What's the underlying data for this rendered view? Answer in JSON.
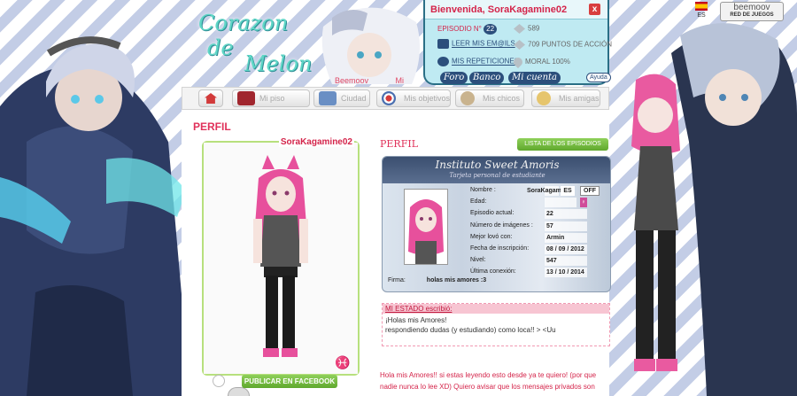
{
  "header": {
    "logo_line1": "Corazon",
    "logo_line2": "de",
    "logo_line3": "Melon",
    "by_text": "Beemoov",
    "by_suffix": "Mi"
  },
  "panel": {
    "welcome": "Bienvenida, SoraKagamine02",
    "close": "x",
    "episode_label": "EPISODIO N°",
    "episode_number": "22",
    "read_emails": "LEER MIS EM@ILS",
    "repetitions": "MIS REPETICIONES",
    "stat_coins": "589",
    "stat_action": "709 PUNTOS DE ACCIÓN",
    "stat_moral": "MORAL 100%",
    "buttons": [
      "Foro",
      "Banco",
      "Mi cuenta"
    ],
    "help": "Ayuda"
  },
  "lang": "ES",
  "beemoov": {
    "title": "beemoov",
    "sub": "RED DE JUEGOS"
  },
  "nav": {
    "tabs": [
      "Mi piso",
      "Ciudad",
      "Mis objetivos",
      "Mis chicos",
      "Mis amigas"
    ]
  },
  "profile": {
    "page_title": "PERFIL",
    "username": "SoraKagamine02",
    "facebook_button": "PUBLICAR EN FACEBOOK",
    "perfil_subtitle": "PERFIL",
    "episodes_button": "LISTA DE LOS EPISODIOS",
    "zodiac": "♓"
  },
  "idcard": {
    "title": "Instituto Sweet Amoris",
    "subtitle": "Tarjeta personal de estudiante",
    "rows": [
      {
        "label": "Nombre :",
        "value": "SoraKagam...",
        "extra": "ES",
        "badge": "OFF"
      },
      {
        "label": "Edad:",
        "value": "",
        "gender": "♀"
      },
      {
        "label": "Episodio actual:",
        "value": "22"
      },
      {
        "label": "Número de imágenes :",
        "value": "57"
      },
      {
        "label": "Mejor lovó con:",
        "value": "Armin"
      },
      {
        "label": "Fecha de inscripción:",
        "value": "08 / 09 / 2012"
      },
      {
        "label": "Nivel:",
        "value": "547"
      },
      {
        "label": "Última conexión:",
        "value": "13 / 10 / 2014"
      }
    ],
    "firma_label": "Firma:",
    "firma_value": "holas mis amores :3"
  },
  "estado": {
    "header": "MI ESTADO escribió:",
    "line1": "¡Holas mis Amores!",
    "line2": "respondiendo dudas (y estudiando) como loca!! > <Uu"
  },
  "message": "Hola mis Amores!! si estas leyendo esto desde ya te quiero! (por que nadie nunca lo lee XD) Quiero avisar que los mensajes privados son",
  "colors": {
    "accent_pink": "#e0315a",
    "panel_blue": "#bfeaf2",
    "button_green": "#6fbd3a"
  }
}
